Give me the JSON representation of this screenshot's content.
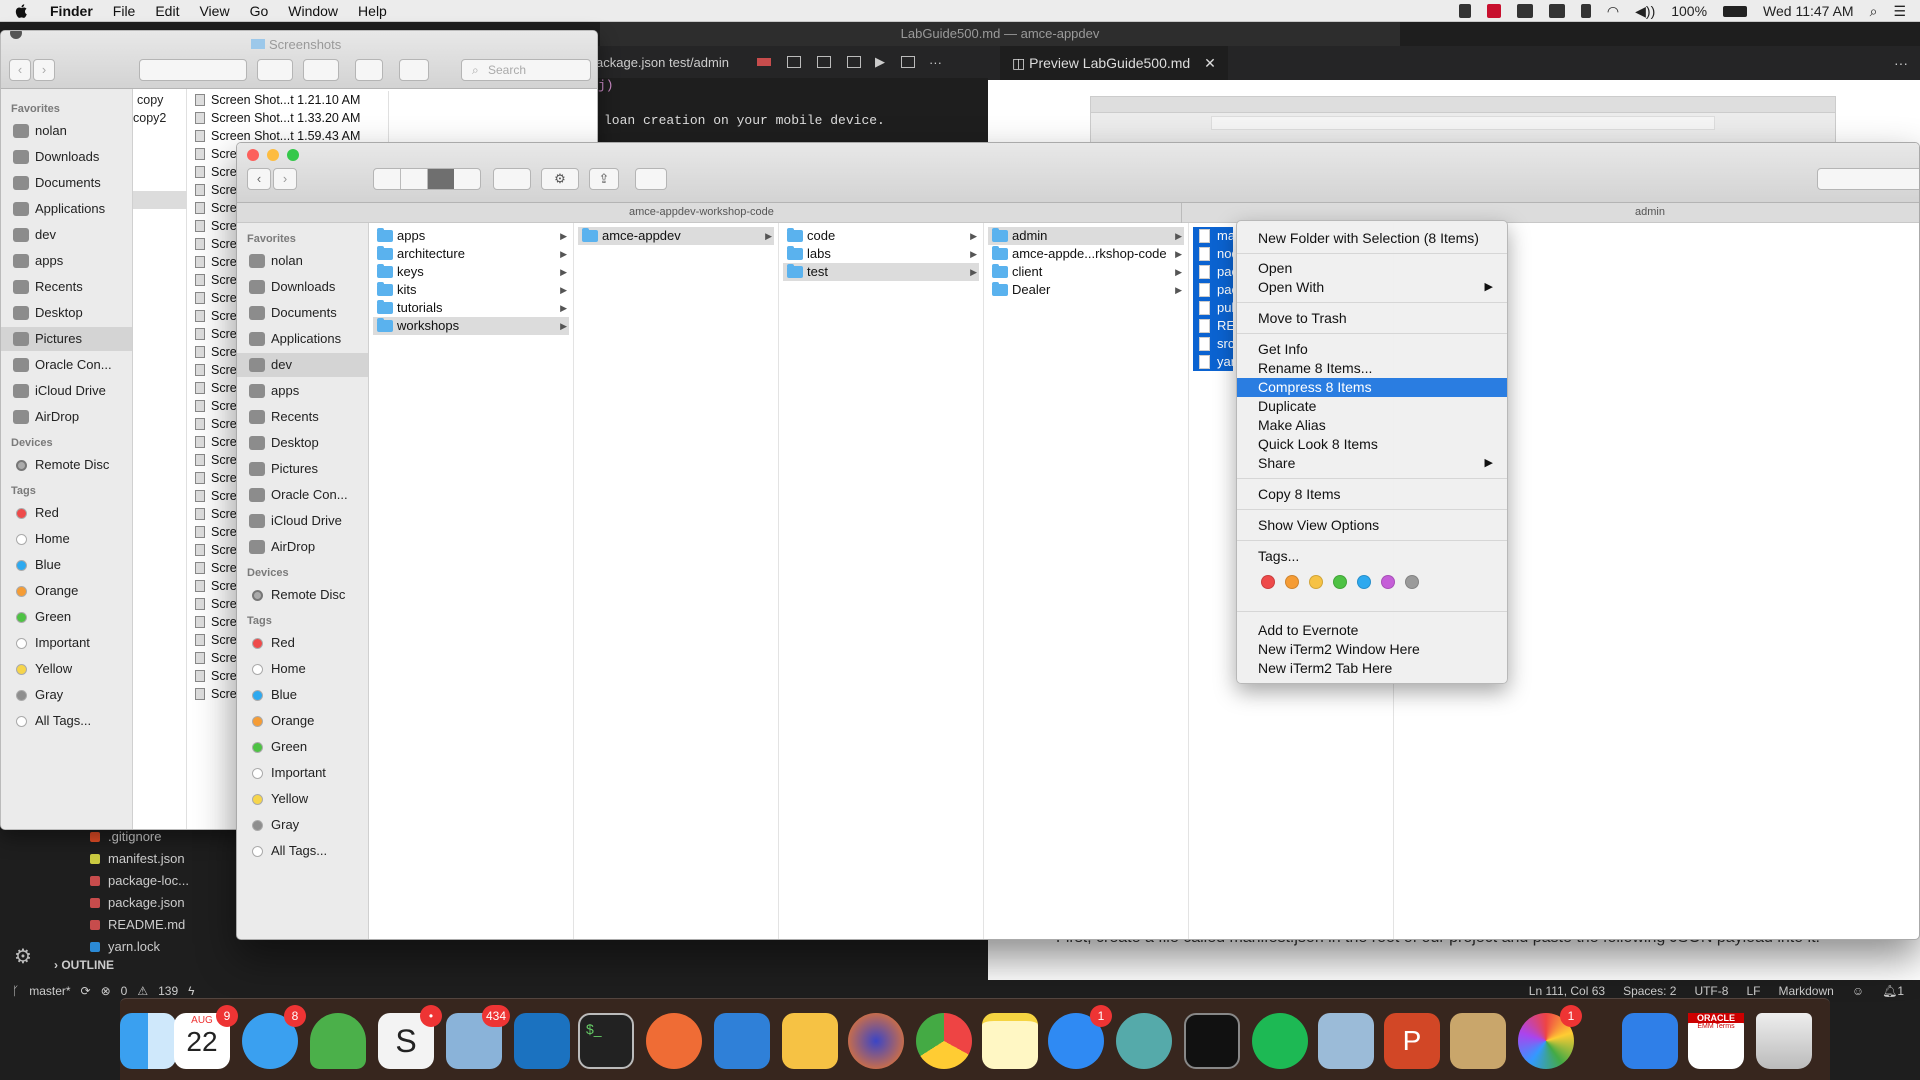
{
  "menubar": {
    "app": "Finder",
    "items": [
      "File",
      "Edit",
      "View",
      "Go",
      "Window",
      "Help"
    ],
    "battery": "100%",
    "clock": "Wed 11:47 AM"
  },
  "vscode": {
    "window_title": "LabGuide500.md — amce-appdev",
    "tab_path": "ackage.json test/admin",
    "code_line1": "j)",
    "code_line2": "loan creation on your mobile device.",
    "preview_tab": "Preview LabGuide500.md",
    "explorer": [
      {
        "name": ".gitignore",
        "color": "#e44d26"
      },
      {
        "name": "manifest.json",
        "color": "#cbcb41"
      },
      {
        "name": "package-loc...",
        "color": "#c74c4c"
      },
      {
        "name": "package.json",
        "color": "#c74c4c"
      },
      {
        "name": "README.md",
        "color": "#c74c4c"
      },
      {
        "name": "yarn.lock",
        "color": "#2b8ad6"
      }
    ],
    "outline": "OUTLINE",
    "status_branch": "master*",
    "status_errors": "0",
    "status_warnings": "139",
    "status_position": "Ln 111, Col 63",
    "status_spaces": "Spaces: 2",
    "status_encoding": "UTF-8",
    "status_eol": "LF",
    "status_lang": "Markdown",
    "status_bell": "1",
    "preview_text": "First, create a file called manifest.json in the root of our project and paste the following JSON payload into it:",
    "preview_shot_label": "admin"
  },
  "finder_back": {
    "title": "Screenshots",
    "search_placeholder": "Search",
    "favorites_header": "Favorites",
    "favorites": [
      "nolan",
      "Downloads",
      "Documents",
      "Applications",
      "dev",
      "apps",
      "Recents",
      "Desktop",
      "Pictures",
      "Oracle Con...",
      "iCloud Drive",
      "AirDrop"
    ],
    "selected_favorite": "Pictures",
    "devices_header": "Devices",
    "devices": [
      "Remote Disc"
    ],
    "tags_header": "Tags",
    "tags": [
      {
        "name": "Red",
        "color": "#ee4a4a"
      },
      {
        "name": "Home",
        "color": "#ffffff"
      },
      {
        "name": "Blue",
        "color": "#2ea9ef"
      },
      {
        "name": "Orange",
        "color": "#f59c35"
      },
      {
        "name": "Green",
        "color": "#4ec244"
      },
      {
        "name": "Important",
        "color": "#ffffff"
      },
      {
        "name": "Yellow",
        "color": "#f6d54b"
      },
      {
        "name": "Gray",
        "color": "#8e8e8e"
      },
      {
        "name": "All Tags...",
        "color": "#ffffff"
      }
    ],
    "col1": [
      "copy",
      "copy2"
    ],
    "shots": [
      "Screen Shot...t 1.21.10 AM",
      "Screen Shot...t 1.33.20 AM",
      "Screen Shot...t 1.59.43 AM"
    ],
    "scr_label": "Scre"
  },
  "finder_front": {
    "path_left": "amce-appdev-workshop-code",
    "path_right": "admin",
    "favorites_header": "Favorites",
    "favorites": [
      "nolan",
      "Downloads",
      "Documents",
      "Applications",
      "dev",
      "apps",
      "Recents",
      "Desktop",
      "Pictures",
      "Oracle Con...",
      "iCloud Drive",
      "AirDrop"
    ],
    "selected_favorite": "dev",
    "devices_header": "Devices",
    "devices": [
      "Remote Disc"
    ],
    "tags_header": "Tags",
    "tags": [
      {
        "name": "Red",
        "color": "#ee4a4a"
      },
      {
        "name": "Home",
        "color": "#ffffff"
      },
      {
        "name": "Blue",
        "color": "#2ea9ef"
      },
      {
        "name": "Orange",
        "color": "#f59c35"
      },
      {
        "name": "Green",
        "color": "#4ec244"
      },
      {
        "name": "Important",
        "color": "#ffffff"
      },
      {
        "name": "Yellow",
        "color": "#f6d54b"
      },
      {
        "name": "Gray",
        "color": "#8e8e8e"
      },
      {
        "name": "All Tags...",
        "color": "#ffffff"
      }
    ],
    "col1": [
      {
        "name": "apps",
        "hl": false
      },
      {
        "name": "architecture",
        "hl": false
      },
      {
        "name": "keys",
        "hl": false
      },
      {
        "name": "kits",
        "hl": false
      },
      {
        "name": "tutorials",
        "hl": false
      },
      {
        "name": "workshops",
        "hl": true
      }
    ],
    "col2": [
      {
        "name": "amce-appdev",
        "hl": true
      }
    ],
    "col3": [
      {
        "name": "code",
        "hl": false
      },
      {
        "name": "labs",
        "hl": false
      },
      {
        "name": "test",
        "hl": true
      }
    ],
    "col4": [
      {
        "name": "admin",
        "hl": true
      },
      {
        "name": "amce-appde...rkshop-code",
        "hl": false
      },
      {
        "name": "client",
        "hl": false
      },
      {
        "name": "Dealer",
        "hl": false
      }
    ],
    "col5": [
      "man",
      "nod",
      "pac",
      "pac",
      "pub",
      "REA",
      "src",
      "yar"
    ]
  },
  "context_menu": {
    "new_folder": "New Folder with Selection (8 Items)",
    "open": "Open",
    "open_with": "Open With",
    "trash": "Move to Trash",
    "get_info": "Get Info",
    "rename": "Rename 8 Items...",
    "compress": "Compress 8 Items",
    "duplicate": "Duplicate",
    "alias": "Make Alias",
    "quicklook": "Quick Look 8 Items",
    "share": "Share",
    "copy": "Copy 8 Items",
    "view_options": "Show View Options",
    "tags": "Tags...",
    "tag_colors": [
      "#ee4a4a",
      "#f59c35",
      "#f6c244",
      "#4ec244",
      "#2ea9ef",
      "#c55ed8",
      "#9a9a9a"
    ],
    "evernote": "Add to Evernote",
    "iterm_window": "New iTerm2 Window Here",
    "iterm_tab": "New iTerm2 Tab Here"
  },
  "dock": {
    "calendar_month": "AUG",
    "calendar_day": "22",
    "badges": {
      "calendar": "9",
      "messages": "8",
      "slack": "•",
      "mail": "434",
      "appstore": "1",
      "other": "1"
    },
    "oracle_label": "ORACLE",
    "oracle_sub": "EMM Terms"
  }
}
